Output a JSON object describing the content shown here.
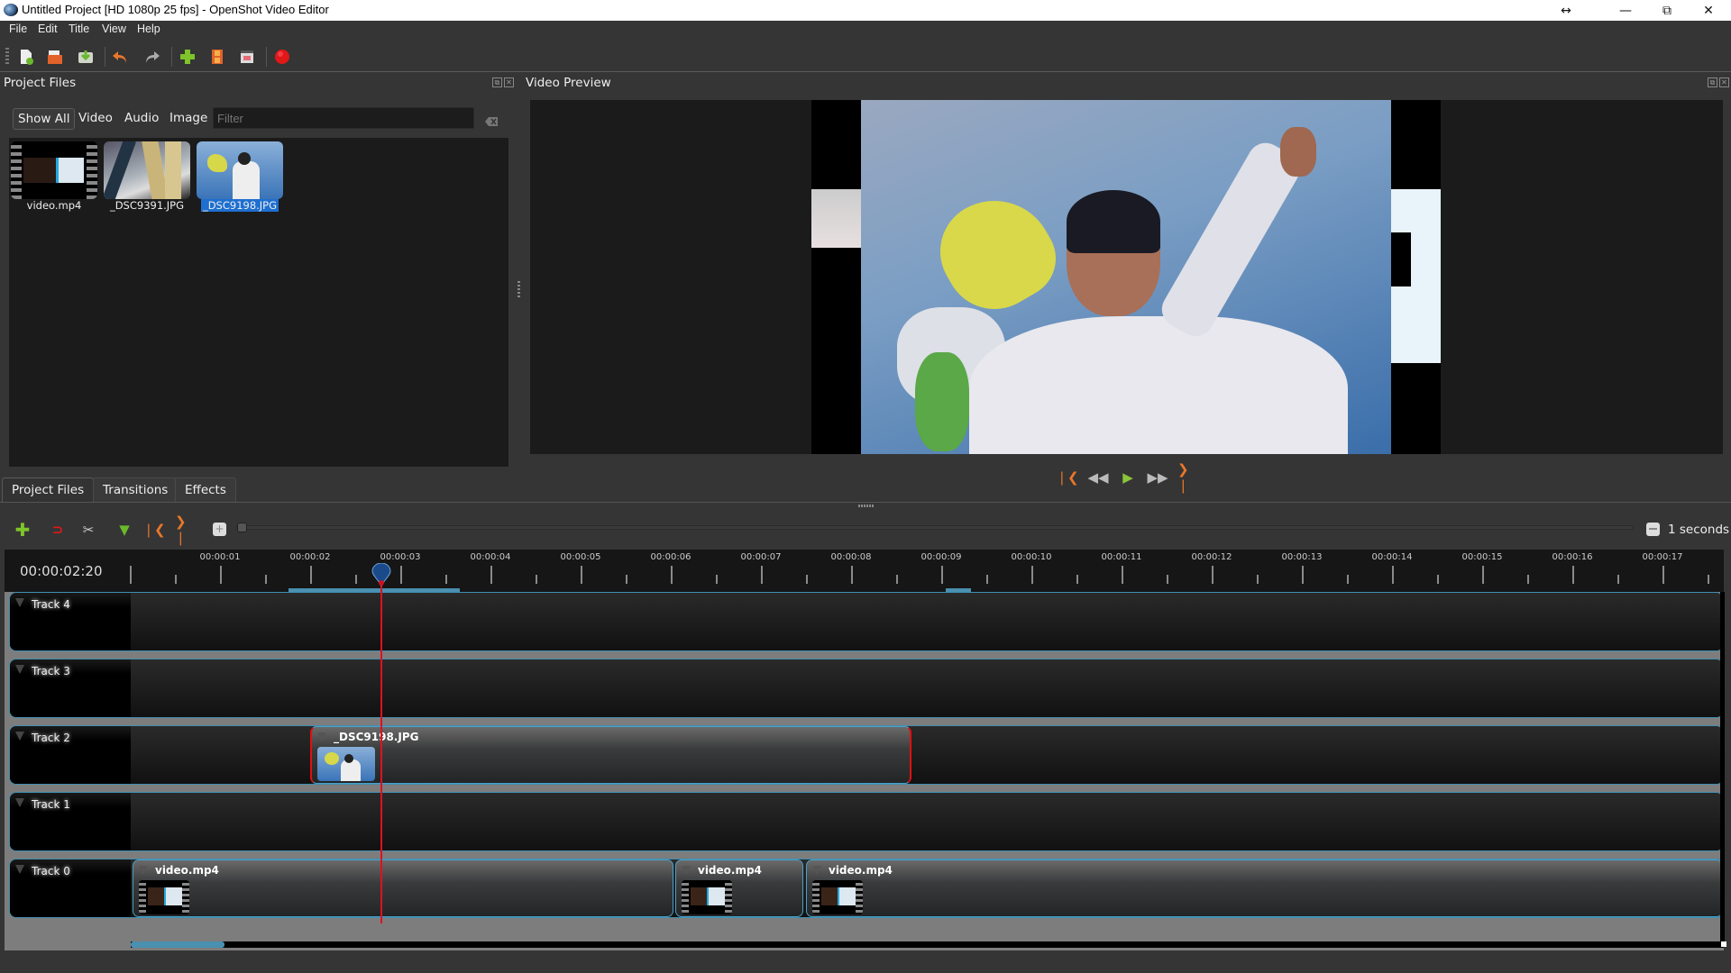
{
  "window": {
    "title": "Untitled Project [HD 1080p 25 fps] - OpenShot Video Editor"
  },
  "menu": [
    "File",
    "Edit",
    "Title",
    "View",
    "Help"
  ],
  "toolbar": {
    "icons": [
      "new-project-icon",
      "open-project-icon",
      "save-project-icon",
      "undo-icon",
      "redo-icon",
      "import-files-icon",
      "choose-profile-icon",
      "fullscreen-icon",
      "export-video-icon"
    ]
  },
  "project_files": {
    "title": "Project Files",
    "filters": [
      "Show All",
      "Video",
      "Audio",
      "Image"
    ],
    "active_filter": "Show All",
    "filter_placeholder": "Filter",
    "files": [
      {
        "name": "video.mp4",
        "type": "video",
        "selected": false
      },
      {
        "name": "_DSC9391.JPG",
        "type": "image",
        "selected": false
      },
      {
        "name": "_DSC9198.JPG",
        "type": "image",
        "selected": true
      }
    ]
  },
  "video_preview": {
    "title": "Video Preview"
  },
  "playback": {
    "buttons": [
      "jump-start",
      "rewind",
      "play",
      "fast-forward",
      "jump-end"
    ]
  },
  "bottom_tabs": [
    "Project Files",
    "Transitions",
    "Effects"
  ],
  "active_bottom_tab": "Project Files",
  "timeline": {
    "zoom_label": "1 seconds",
    "current_time": "00:00:02:20",
    "ruler_labels": [
      "00:00:01",
      "00:00:02",
      "00:00:03",
      "00:00:04",
      "00:00:05",
      "00:00:06",
      "00:00:07",
      "00:00:08",
      "00:00:09",
      "00:00:10",
      "00:00:11",
      "00:00:12",
      "00:00:13",
      "00:00:14",
      "00:00:15",
      "00:00:16",
      "00:00:17"
    ],
    "playhead_seconds": 2.8,
    "tracks": [
      {
        "name": "Track 4",
        "clips": []
      },
      {
        "name": "Track 3",
        "clips": []
      },
      {
        "name": "Track 2",
        "clips": [
          {
            "name": "_DSC9198.JPG",
            "start": 1.99,
            "end": 8.66,
            "selected": true,
            "kind": "image"
          }
        ]
      },
      {
        "name": "Track 1",
        "clips": []
      },
      {
        "name": "Track 0",
        "clips": [
          {
            "name": "video.mp4",
            "start": 0.02,
            "end": 6.02,
            "kind": "video"
          },
          {
            "name": "video.mp4",
            "start": 6.04,
            "end": 7.46,
            "kind": "video"
          },
          {
            "name": "video.mp4",
            "start": 7.49,
            "end": 17.66,
            "kind": "video"
          }
        ]
      }
    ]
  }
}
